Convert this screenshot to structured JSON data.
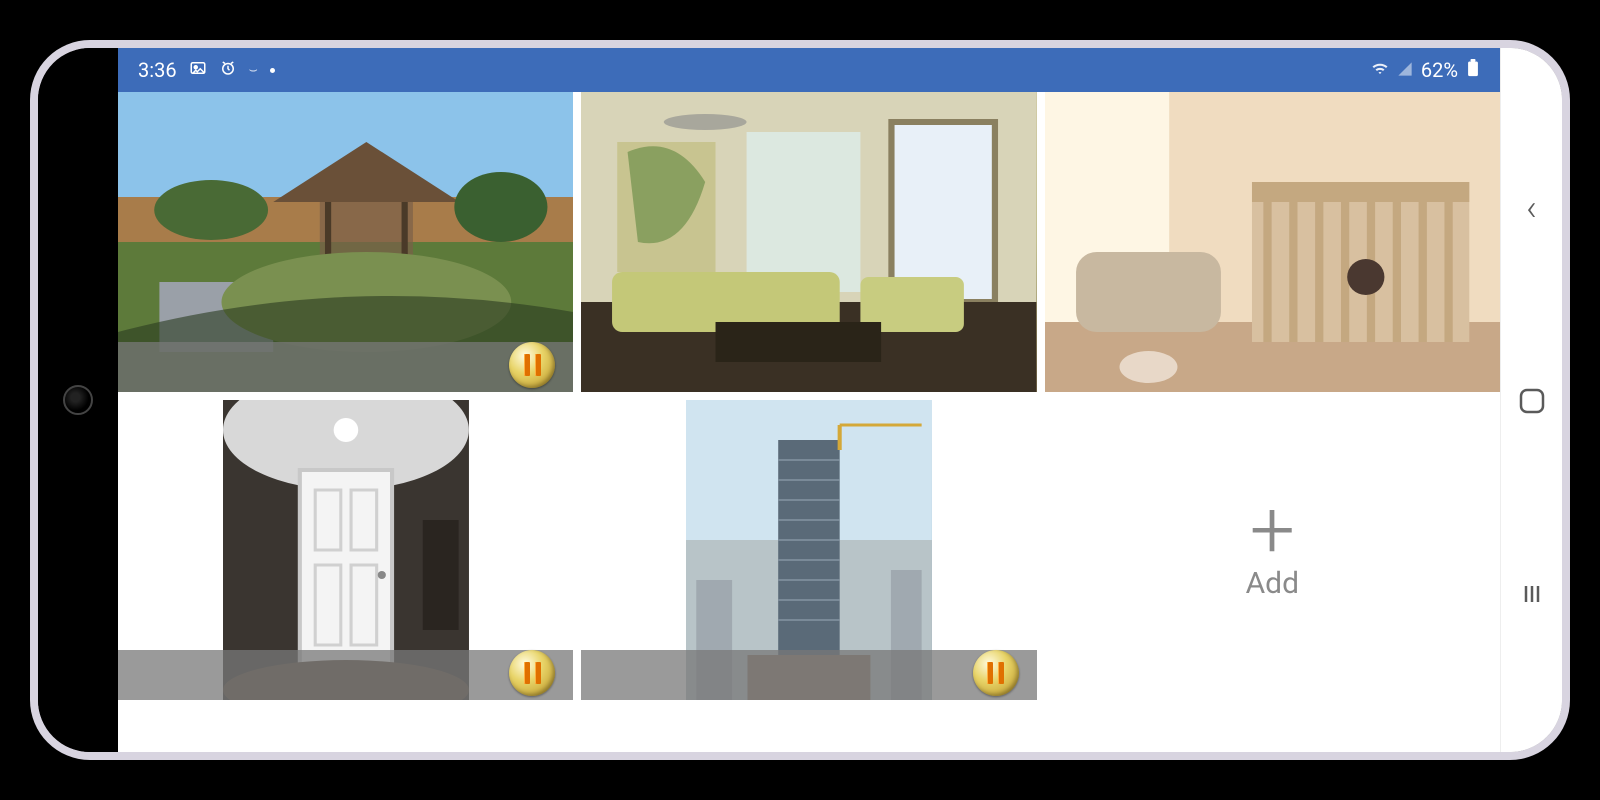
{
  "status": {
    "time": "3:36",
    "battery": "62%",
    "indicators": [
      "image-icon",
      "alarm-icon",
      "link-icon",
      "dot-indicator"
    ],
    "right_icons": [
      "wifi-icon",
      "signal-icon",
      "battery-icon"
    ]
  },
  "cameras": [
    {
      "name": "backyard",
      "paused": true,
      "aspect": "landscape"
    },
    {
      "name": "living-room",
      "paused": false,
      "aspect": "landscape"
    },
    {
      "name": "nursery",
      "paused": false,
      "aspect": "landscape"
    },
    {
      "name": "front-door",
      "paused": true,
      "aspect": "portrait"
    },
    {
      "name": "construction",
      "paused": true,
      "aspect": "portrait"
    }
  ],
  "add": {
    "label": "Add"
  },
  "nav": {
    "back": "‹",
    "home": "◯",
    "recent": "|||"
  }
}
